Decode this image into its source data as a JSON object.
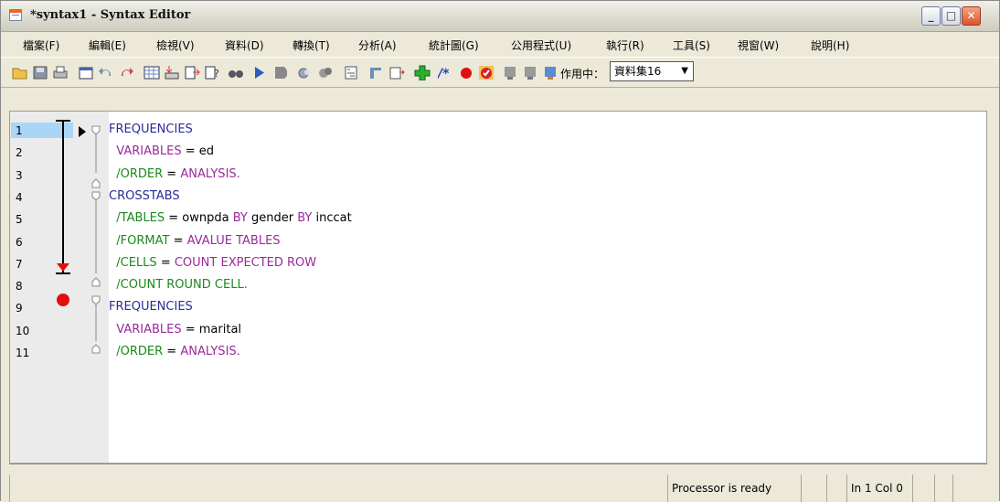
{
  "window": {
    "title": "*syntax1 - Syntax Editor"
  },
  "menu": [
    "檔案(F)",
    "編輯(E)",
    "檢視(V)",
    "資料(D)",
    "轉換(T)",
    "分析(A)",
    "統計圖(G)",
    "公用程式(U)",
    "執行(R)",
    "工具(S)",
    "視窗(W)",
    "說明(H)"
  ],
  "toolbar": {
    "active_label": "作用中：",
    "dataset_value": "資料集16",
    "icons": [
      "open-icon",
      "save-icon",
      "print-icon",
      "dialog-recall-icon",
      "undo-icon",
      "redo-icon",
      "goto-data-icon",
      "goto-case-icon",
      "variables-icon",
      "insert-variable-icon",
      "find-icon",
      "run-icon",
      "stop-icon",
      "toggle-breakpoint-icon",
      "clear-breakpoints-icon",
      "bookmark-icon",
      "next-bookmark-icon",
      "case-icon",
      "insert-icon",
      "add-icon",
      "comment-icon",
      "breakpoint-icon",
      "validate-icon",
      "block-icon",
      "block2-icon",
      "block3-icon"
    ]
  },
  "editor": {
    "line_numbers": [
      "1",
      "2",
      "3",
      "4",
      "5",
      "6",
      "7",
      "8",
      "9",
      "10",
      "11"
    ],
    "lines": [
      [
        {
          "t": "FREQUENCIES",
          "c": "kw"
        }
      ],
      [
        {
          "t": "  VARIABLES",
          "c": "val"
        },
        {
          "t": " = ed",
          "c": "txt"
        }
      ],
      [
        {
          "t": "  /ORDER",
          "c": "sub"
        },
        {
          "t": " = ",
          "c": "txt"
        },
        {
          "t": "ANALYSIS.",
          "c": "val"
        }
      ],
      [
        {
          "t": "CROSSTABS",
          "c": "kw"
        }
      ],
      [
        {
          "t": "  /TABLES",
          "c": "sub"
        },
        {
          "t": " = ownpda ",
          "c": "txt"
        },
        {
          "t": "BY",
          "c": "val"
        },
        {
          "t": " gender ",
          "c": "txt"
        },
        {
          "t": "BY",
          "c": "val"
        },
        {
          "t": " inccat",
          "c": "txt"
        }
      ],
      [
        {
          "t": "  /FORMAT",
          "c": "sub"
        },
        {
          "t": " = ",
          "c": "txt"
        },
        {
          "t": "AVALUE TABLES",
          "c": "val"
        }
      ],
      [
        {
          "t": "  /CELLS",
          "c": "sub"
        },
        {
          "t": " = ",
          "c": "txt"
        },
        {
          "t": "COUNT EXPECTED ROW",
          "c": "val"
        }
      ],
      [
        {
          "t": "  /COUNT ROUND CELL.",
          "c": "sub"
        }
      ],
      [
        {
          "t": "FREQUENCIES",
          "c": "kw"
        }
      ],
      [
        {
          "t": "  VARIABLES",
          "c": "val"
        },
        {
          "t": " = marital",
          "c": "txt"
        }
      ],
      [
        {
          "t": "  /ORDER",
          "c": "sub"
        },
        {
          "t": " = ",
          "c": "txt"
        },
        {
          "t": "ANALYSIS.",
          "c": "val"
        }
      ]
    ]
  },
  "status": {
    "processor": "Processor is ready",
    "position": "In 1 Col 0"
  }
}
